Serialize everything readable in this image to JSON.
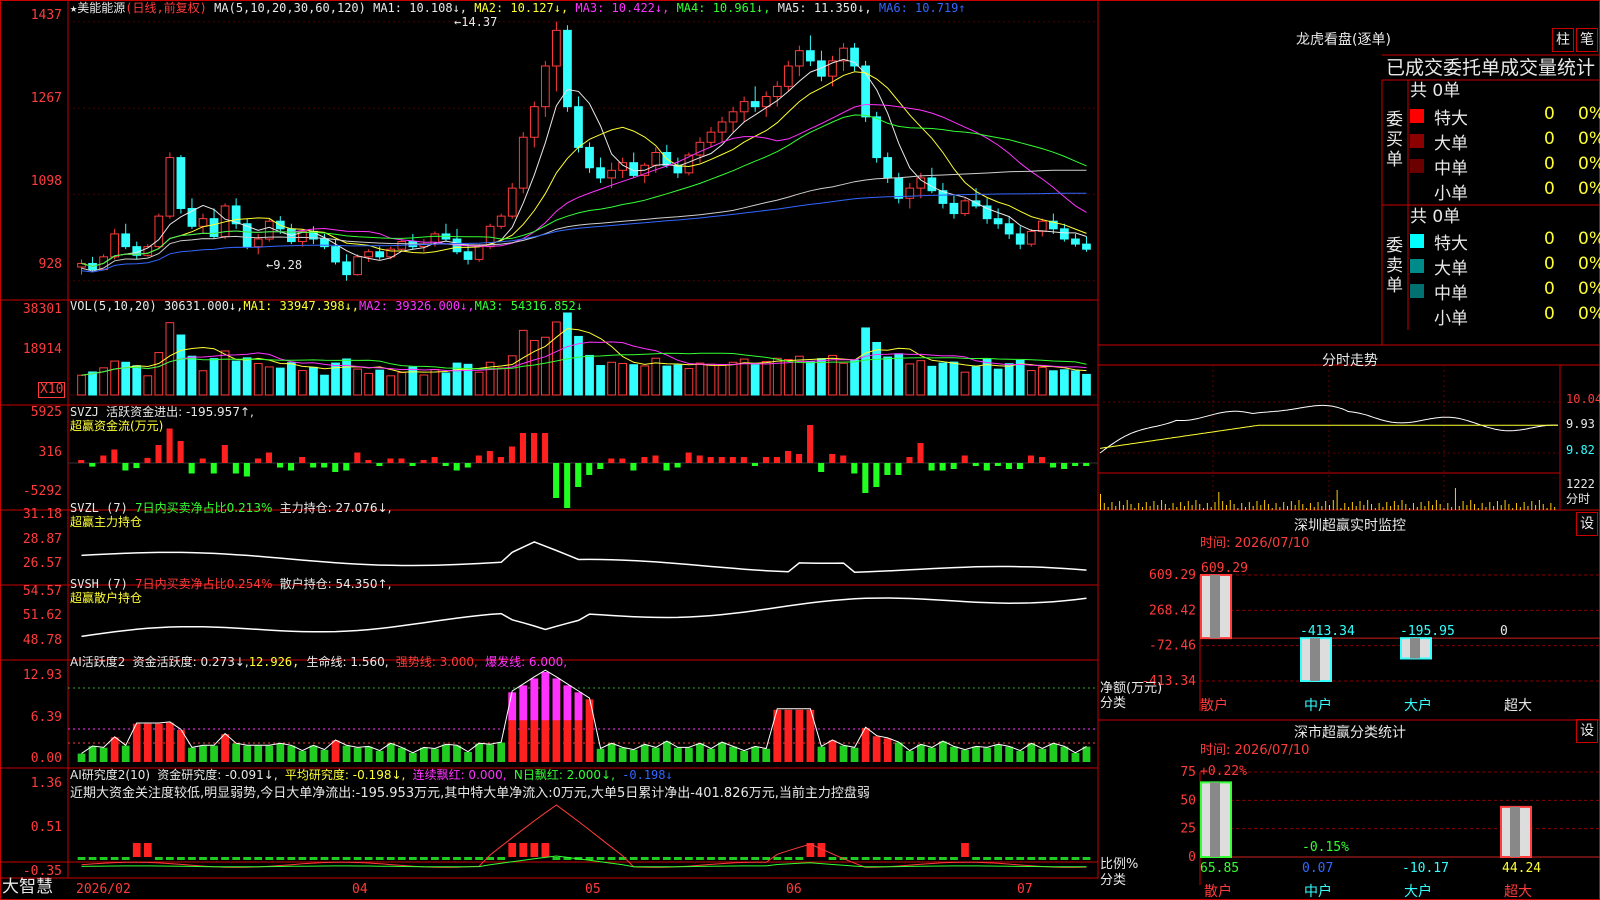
{
  "stock": {
    "name_line": "★美能能源",
    "mode": "(日线,前复权)",
    "ma_params": "MA(5,10,20,30,60,120)",
    "ma1": "MA1: 10.108↓,",
    "ma2": "MA2: 10.127↓,",
    "ma3": "MA3: 10.422↓,",
    "ma4": "MA4: 10.961↓,",
    "ma5": "MA5: 11.350↓,",
    "ma6": "MA6: 10.719↑",
    "peak_label": "←14.37",
    "low_label": "←9.28",
    "y_ticks": [
      "1437",
      "1267",
      "1098",
      "928"
    ]
  },
  "vol": {
    "header": "VOL(5,10,20)",
    "v": "30631.000↓,",
    "ma1": "MA1: 33947.398↓,",
    "ma2": "MA2: 39326.000↓,",
    "ma3": "MA3: 54316.852↓",
    "y_ticks": [
      "38301",
      "18914"
    ],
    "unit": "X10"
  },
  "svzj": {
    "header": "SVZJ",
    "label": "活跃资金进出: -195.957↑,",
    "sub": "超赢资金流(万元)",
    "y_ticks": [
      "5925",
      "316",
      "-5292"
    ]
  },
  "svzl": {
    "header": "SVZL (7)",
    "label_a": "7日内买卖净占比0.213%",
    "label_b": "主力持仓: 27.076↓,",
    "sub": "超赢主力持仓",
    "y_ticks": [
      "31.18",
      "28.87",
      "26.57"
    ]
  },
  "svsh": {
    "header": "SVSH (7)",
    "label_a": "7日内买卖净占比0.254%",
    "label_b": "散户持仓: 54.350↑,",
    "sub": "超赢散户持仓",
    "y_ticks": [
      "54.57",
      "51.62",
      "48.78"
    ]
  },
  "ai1": {
    "header": "AI活跃度2",
    "label": "资金活跃度: 0.273↓,",
    "v2": "12.926,",
    "life": "生命线: 1.560,",
    "strong": "强势线: 3.000,",
    "burst": "爆发线: 6.000,",
    "y_ticks": [
      "12.93",
      "6.39",
      "0.00"
    ]
  },
  "ai2": {
    "header": "AI研究度2(10)",
    "label": "资金研究度: -0.091↓,",
    "avg": "平均研究度: -0.198↓,",
    "cont": "连续飘红: 0.000,",
    "n": "N日飘红: 2.000↓,",
    "last": "-0.198↓",
    "comment": "近期大资金关注度较低,明显弱势,今日大单净流出:-195.953万元,其中特大单净流入:0万元,大单5日累计净出-401.826万元,当前主力控盘弱",
    "y_ticks": [
      "1.36",
      "0.51",
      "-0.35"
    ]
  },
  "footer": {
    "brand": "大智慧",
    "dates": [
      "2026/02",
      "04",
      "05",
      "06",
      "07"
    ]
  },
  "right": {
    "lh_title": "龙虎看盘(逐单)",
    "btn_bar": "柱",
    "btn_pen": "笔",
    "stats_title": "已成交委托单成交量统计",
    "buy_label": "委买单",
    "sell_label": "委卖单",
    "buy_total": "共 0单",
    "sell_total": "共 0单",
    "buy_rows": [
      {
        "name": "特大",
        "count": "0",
        "pct": "0%",
        "color": "#ff0000"
      },
      {
        "name": "大单",
        "count": "0",
        "pct": "0%",
        "color": "#8b0000"
      },
      {
        "name": "中单",
        "count": "0",
        "pct": "0%",
        "color": "#6b0000"
      },
      {
        "name": "小单",
        "count": "0",
        "pct": "0%",
        "color": ""
      }
    ],
    "sell_rows": [
      {
        "name": "特大",
        "count": "0",
        "pct": "0%",
        "color": "#00ffff"
      },
      {
        "name": "大单",
        "count": "0",
        "pct": "0%",
        "color": "#008b8b"
      },
      {
        "name": "中单",
        "count": "0",
        "pct": "0%",
        "color": "#007070"
      },
      {
        "name": "小单",
        "count": "0",
        "pct": "0%",
        "color": ""
      }
    ],
    "intraday_title": "分时走势",
    "intraday_ticks": [
      "10.04",
      "9.93",
      "9.82"
    ],
    "intraday_vol": "1222",
    "intraday_unit": "分时",
    "monitor_title": "深圳超赢实时监控",
    "monitor_btn": "设",
    "monitor_time": "时间: 2026/07/10",
    "monitor_unit": "净额(万元)",
    "monitor_cat": "分类",
    "class_title": "深市超赢分类统计",
    "class_btn": "设",
    "class_time": "时间: 2026/07/10",
    "class_unit": "比例%",
    "class_cat": "分类"
  },
  "chart_data": [
    {
      "type": "bar",
      "title": "深圳超赢实时监控",
      "ylabel": "净额(万元)",
      "categories": [
        "散户",
        "中户",
        "大户",
        "超大"
      ],
      "values": [
        609.29,
        -413.34,
        -195.95,
        0
      ],
      "value_labels": [
        "609.29",
        "-413.34",
        "-195.95",
        "0"
      ],
      "y_ticks": [
        "609.29",
        "268.42",
        "-72.46",
        "-413.34"
      ],
      "ylim": [
        -413.34,
        609.29
      ]
    },
    {
      "type": "bar",
      "title": "深市超赢分类统计",
      "ylabel": "比例%",
      "categories": [
        "散户",
        "中户",
        "大户",
        "超大"
      ],
      "values": [
        65.85,
        0.07,
        -10.17,
        44.24
      ],
      "value_labels": [
        "+0.22%",
        "-0.15%",
        "",
        ""
      ],
      "bottom_labels": [
        "65.85",
        "0.07",
        "-10.17",
        "44.24"
      ],
      "y_ticks": [
        "75",
        "50",
        "25",
        "0"
      ],
      "ylim": [
        0,
        75
      ]
    },
    {
      "type": "line",
      "title": "美能能源 日线",
      "price_range": [
        9.28,
        14.37
      ],
      "candles": [
        [
          9.55,
          9.7,
          9.4,
          9.62
        ],
        [
          9.62,
          9.75,
          9.45,
          9.5
        ],
        [
          9.5,
          9.8,
          9.48,
          9.75
        ],
        [
          9.75,
          10.3,
          9.7,
          10.2
        ],
        [
          10.2,
          10.4,
          9.9,
          9.95
        ],
        [
          9.95,
          10.05,
          9.7,
          9.78
        ],
        [
          9.78,
          10.0,
          9.75,
          9.95
        ],
        [
          9.95,
          10.6,
          9.9,
          10.55
        ],
        [
          10.55,
          11.8,
          10.5,
          11.7
        ],
        [
          11.7,
          11.75,
          10.6,
          10.7
        ],
        [
          10.7,
          10.9,
          10.3,
          10.35
        ],
        [
          10.35,
          10.6,
          10.2,
          10.5
        ],
        [
          10.5,
          10.7,
          10.1,
          10.15
        ],
        [
          10.15,
          10.8,
          10.1,
          10.75
        ],
        [
          10.75,
          10.9,
          10.3,
          10.4
        ],
        [
          10.4,
          10.5,
          9.9,
          9.95
        ],
        [
          9.95,
          10.2,
          9.8,
          10.1
        ],
        [
          10.1,
          10.5,
          10.05,
          10.45
        ],
        [
          10.45,
          10.55,
          10.2,
          10.3
        ],
        [
          10.3,
          10.4,
          10.0,
          10.05
        ],
        [
          10.05,
          10.3,
          9.95,
          10.25
        ],
        [
          10.25,
          10.35,
          10.0,
          10.1
        ],
        [
          10.1,
          10.2,
          9.9,
          9.95
        ],
        [
          9.95,
          10.1,
          9.6,
          9.65
        ],
        [
          9.65,
          9.8,
          9.28,
          9.4
        ],
        [
          9.4,
          9.8,
          9.38,
          9.75
        ],
        [
          9.75,
          9.9,
          9.65,
          9.85
        ],
        [
          9.85,
          9.95,
          9.7,
          9.75
        ],
        [
          9.75,
          9.95,
          9.7,
          9.9
        ],
        [
          9.9,
          10.1,
          9.85,
          10.05
        ],
        [
          10.05,
          10.2,
          9.9,
          9.95
        ],
        [
          9.95,
          10.1,
          9.85,
          10.0
        ],
        [
          10.0,
          10.25,
          9.95,
          10.2
        ],
        [
          10.2,
          10.4,
          10.05,
          10.1
        ],
        [
          10.1,
          10.3,
          9.8,
          9.85
        ],
        [
          9.85,
          10.0,
          9.6,
          9.7
        ],
        [
          9.7,
          10.0,
          9.65,
          9.95
        ],
        [
          9.95,
          10.4,
          9.9,
          10.35
        ],
        [
          10.35,
          10.6,
          10.3,
          10.55
        ],
        [
          10.55,
          11.2,
          10.5,
          11.1
        ],
        [
          11.1,
          12.2,
          11.0,
          12.1
        ],
        [
          12.1,
          12.8,
          11.9,
          12.7
        ],
        [
          12.7,
          13.6,
          12.5,
          13.5
        ],
        [
          13.5,
          14.37,
          13.0,
          14.2
        ],
        [
          14.2,
          14.3,
          12.6,
          12.7
        ],
        [
          12.7,
          12.9,
          11.8,
          11.9
        ],
        [
          11.9,
          12.0,
          11.4,
          11.5
        ],
        [
          11.5,
          11.7,
          11.2,
          11.3
        ],
        [
          11.3,
          11.6,
          11.1,
          11.45
        ],
        [
          11.45,
          11.7,
          11.3,
          11.6
        ],
        [
          11.6,
          11.8,
          11.3,
          11.35
        ],
        [
          11.35,
          11.6,
          11.2,
          11.55
        ],
        [
          11.55,
          11.9,
          11.4,
          11.8
        ],
        [
          11.8,
          11.95,
          11.5,
          11.55
        ],
        [
          11.55,
          11.7,
          11.3,
          11.4
        ],
        [
          11.4,
          11.8,
          11.35,
          11.75
        ],
        [
          11.75,
          12.1,
          11.6,
          12.0
        ],
        [
          12.0,
          12.3,
          11.9,
          12.2
        ],
        [
          12.2,
          12.5,
          12.0,
          12.4
        ],
        [
          12.4,
          12.7,
          12.2,
          12.6
        ],
        [
          12.6,
          12.9,
          12.4,
          12.8
        ],
        [
          12.8,
          13.1,
          12.6,
          12.7
        ],
        [
          12.7,
          13.0,
          12.5,
          12.9
        ],
        [
          12.9,
          13.2,
          12.7,
          13.1
        ],
        [
          13.1,
          13.6,
          13.0,
          13.5
        ],
        [
          13.5,
          13.9,
          13.3,
          13.8
        ],
        [
          13.8,
          14.1,
          13.5,
          13.6
        ],
        [
          13.6,
          13.8,
          13.2,
          13.3
        ],
        [
          13.3,
          13.7,
          13.1,
          13.6
        ],
        [
          13.6,
          13.95,
          13.4,
          13.85
        ],
        [
          13.85,
          13.95,
          13.4,
          13.5
        ],
        [
          13.5,
          13.6,
          12.4,
          12.5
        ],
        [
          12.5,
          12.6,
          11.6,
          11.7
        ],
        [
          11.7,
          11.8,
          11.2,
          11.3
        ],
        [
          11.3,
          11.4,
          10.8,
          10.9
        ],
        [
          10.9,
          11.2,
          10.7,
          11.1
        ],
        [
          11.1,
          11.4,
          10.9,
          11.3
        ],
        [
          11.3,
          11.5,
          11.0,
          11.05
        ],
        [
          11.05,
          11.2,
          10.7,
          10.8
        ],
        [
          10.8,
          10.95,
          10.5,
          10.6
        ],
        [
          10.6,
          10.9,
          10.55,
          10.85
        ],
        [
          10.85,
          11.1,
          10.7,
          10.75
        ],
        [
          10.75,
          10.9,
          10.4,
          10.5
        ],
        [
          10.5,
          10.7,
          10.3,
          10.4
        ],
        [
          10.4,
          10.55,
          10.1,
          10.2
        ],
        [
          10.2,
          10.35,
          9.9,
          10.0
        ],
        [
          10.0,
          10.3,
          9.95,
          10.25
        ],
        [
          10.25,
          10.5,
          10.15,
          10.45
        ],
        [
          10.45,
          10.6,
          10.2,
          10.3
        ],
        [
          10.3,
          10.4,
          10.05,
          10.1
        ],
        [
          10.1,
          10.2,
          9.95,
          10.0
        ],
        [
          10.0,
          10.15,
          9.85,
          9.9
        ]
      ]
    }
  ]
}
